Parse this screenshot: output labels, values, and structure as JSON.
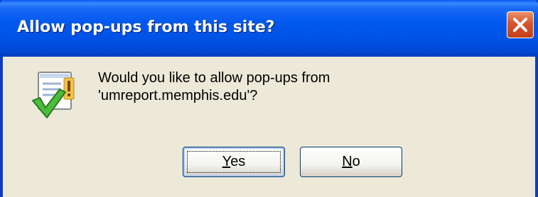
{
  "window": {
    "title": "Allow pop-ups from this site?",
    "close_icon": "close-icon"
  },
  "message": {
    "line1": "Would you like to allow pop-ups from",
    "line2": "'umreport.memphis.edu'?",
    "icon": "popup-allow-checkmark-icon"
  },
  "buttons": {
    "yes": {
      "mnemonic": "Y",
      "rest": "es"
    },
    "no": {
      "mnemonic": "N",
      "rest": "o"
    }
  },
  "colors": {
    "titlebar": "#0058ee",
    "client_background": "#ece9d8",
    "close_button": "#d6542c"
  }
}
